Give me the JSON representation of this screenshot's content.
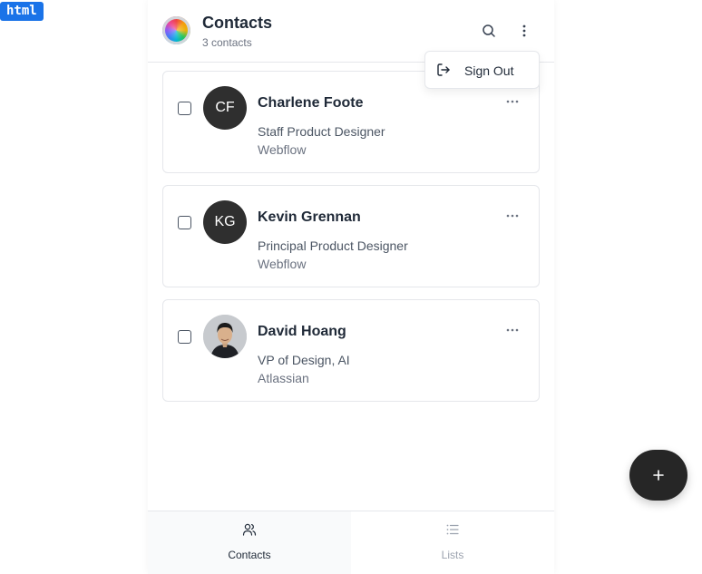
{
  "badge": "html",
  "header": {
    "title": "Contacts",
    "subtitle": "3 contacts",
    "search_icon": "search-icon",
    "menu_icon": "more-vertical-icon"
  },
  "menu": {
    "items": [
      {
        "label": "Sign Out",
        "icon": "sign-out-icon"
      }
    ]
  },
  "contacts": [
    {
      "initials": "CF",
      "name": "Charlene Foote",
      "role": "Staff Product Designer",
      "company": "Webflow",
      "checked": false
    },
    {
      "initials": "KG",
      "name": "Kevin Grennan",
      "role": "Principal Product Designer",
      "company": "Webflow",
      "checked": false
    },
    {
      "initials": "",
      "name": "David Hoang",
      "role": "VP of Design, AI",
      "company": "Atlassian",
      "checked": false,
      "photo": true
    }
  ],
  "bottom_nav": {
    "items": [
      {
        "label": "Contacts",
        "icon": "users-icon",
        "active": true
      },
      {
        "label": "Lists",
        "icon": "list-icon",
        "active": false
      }
    ]
  },
  "fab": {
    "icon": "plus-icon"
  },
  "colors": {
    "accent_dark": "#262626",
    "avatar_bg": "#2f2f2f",
    "border": "#e5e7eb",
    "muted_text": "#6b7280"
  }
}
